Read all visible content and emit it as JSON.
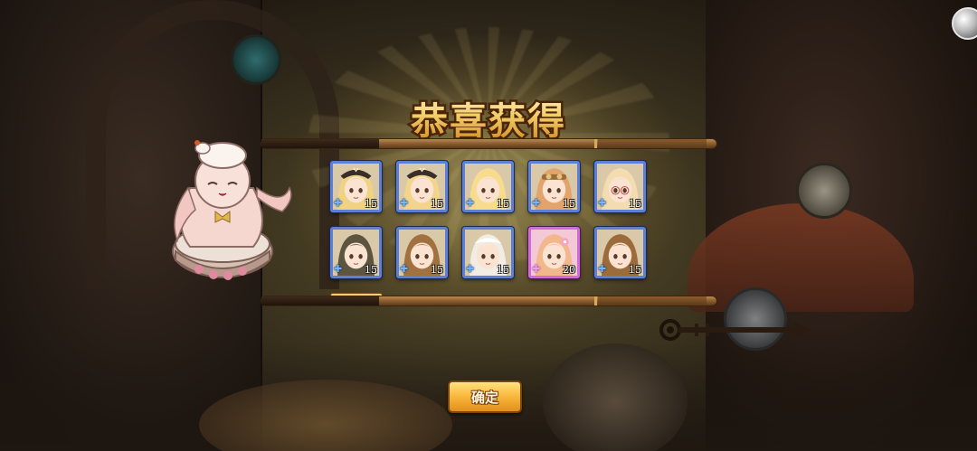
{
  "dialog": {
    "title": "恭喜获得",
    "confirm_label": "确定"
  },
  "rewards": [
    {
      "count": "15",
      "rarity": "blue",
      "hair": "#f0d283",
      "accessory": "hat",
      "icon": "puzzle-piece-icon"
    },
    {
      "count": "15",
      "rarity": "blue",
      "hair": "#f2d48d",
      "accessory": "hat",
      "icon": "puzzle-piece-icon"
    },
    {
      "count": "15",
      "rarity": "blue",
      "hair": "#f7dc8e",
      "accessory": "none",
      "icon": "puzzle-piece-icon"
    },
    {
      "count": "15",
      "rarity": "blue",
      "hair": "#e2a46c",
      "accessory": "goggles",
      "icon": "puzzle-piece-icon"
    },
    {
      "count": "15",
      "rarity": "blue",
      "hair": "#f3dcb0",
      "accessory": "glasses",
      "icon": "puzzle-piece-icon"
    },
    {
      "count": "15",
      "rarity": "blue",
      "hair": "#5e5540",
      "accessory": "none",
      "icon": "puzzle-piece-icon"
    },
    {
      "count": "15",
      "rarity": "blue",
      "hair": "#a1713f",
      "accessory": "none",
      "icon": "puzzle-piece-icon"
    },
    {
      "count": "15",
      "rarity": "blue",
      "hair": "#f1ece4",
      "accessory": "cap",
      "icon": "puzzle-piece-icon"
    },
    {
      "count": "20",
      "rarity": "purple",
      "hair": "#f3b78d",
      "accessory": "flower",
      "icon": "puzzle-piece-icon"
    },
    {
      "count": "15",
      "rarity": "blue",
      "hair": "#9c6b3a",
      "accessory": "none",
      "icon": "puzzle-piece-icon"
    }
  ],
  "colors": {
    "rarity_blue": "#5d7fd6",
    "rarity_purple": "#d06bd8",
    "title_gold": "#f4cf6a",
    "button_orange": "#f8b73a"
  }
}
